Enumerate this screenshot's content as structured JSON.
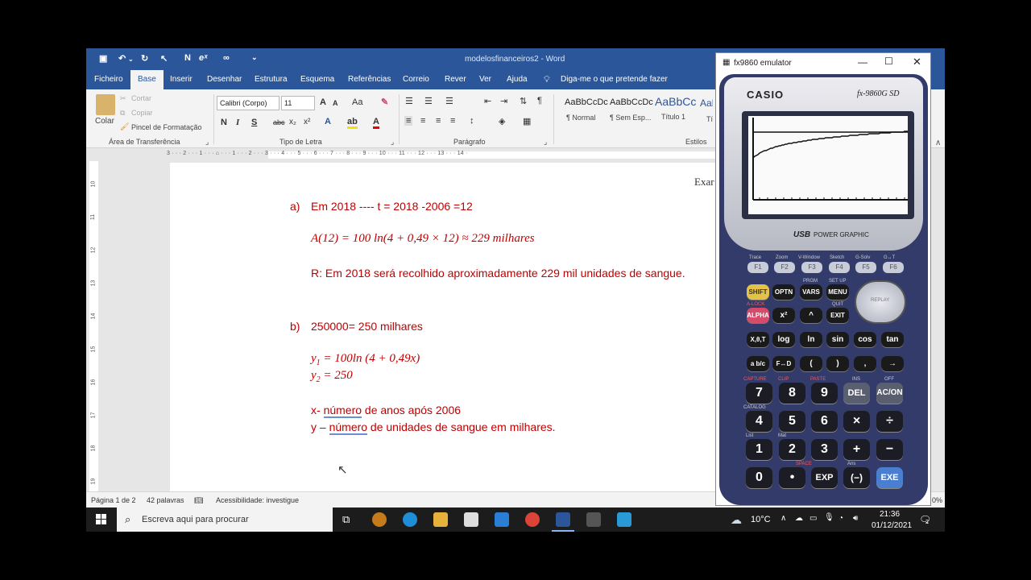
{
  "word": {
    "title": "modelosfinanceiros2 - Word",
    "quick_access": {
      "new_label": "N"
    },
    "tabs": [
      "Ficheiro",
      "Base",
      "Inserir",
      "Desenhar",
      "Estrutura",
      "Esquema",
      "Referências",
      "Correio",
      "Rever",
      "Ver",
      "Ajuda"
    ],
    "active_tab": "Base",
    "tell_me": "Diga-me o que pretende fazer",
    "clipboard": {
      "paste": "Colar",
      "cut": "Cortar",
      "copy": "Copiar",
      "format_painter": "Pincel de Formatação",
      "group": "Área de Transferência"
    },
    "font": {
      "family": "Calibri (Corpo)",
      "size": "11",
      "group": "Tipo de Letra",
      "bold": "N",
      "italic": "I",
      "underline": "S",
      "strike": "abc",
      "sub": "x₂",
      "sup": "x²",
      "grow": "A",
      "shrink": "A",
      "case": "Aa"
    },
    "paragraph": {
      "group": "Parágrafo"
    },
    "styles": {
      "group": "Estilos",
      "items": [
        {
          "sample": "AaBbCcDc",
          "name": "¶ Normal"
        },
        {
          "sample": "AaBbCcDc",
          "name": "¶ Sem Esp..."
        },
        {
          "sample": "AaBbCc",
          "name": "Título 1"
        },
        {
          "sample": "AaB",
          "name": "Tít"
        }
      ]
    },
    "ruler_numbers": "3 · · · 2 · · · 1 · · · ⌂ · · · 1 · · · 2 · · · 3 · · · 4 · · · 5 · · · 6 · · · 7 · · · 8 · · · 9 · · · 10 · · · 11 · · · 12 · · · 13 · · · 14 ·",
    "vruler_numbers": [
      "10",
      "11",
      "12",
      "13",
      "14",
      "15",
      "16",
      "17",
      "18",
      "19"
    ],
    "doc": {
      "header_partial": "Exar",
      "a_label": "a)",
      "a_line": "Em 2018 ---- t = 2018 -2006 =12",
      "a_formula": "A(12) = 100 ln(4 + 0,49 × 12) ≈ 229 milhares",
      "a_answer": "R: Em 2018 será recolhido aproximadamente 229 mil unidades de sangue.",
      "b_label": "b)",
      "b_line": "250000= 250 milhares",
      "y1_var": "y",
      "y1_sub": "1",
      "y1_rest": " = 100ln (4 + 0,49x)",
      "y2_var": "y",
      "y2_sub": "2",
      "y2_rest": " = 250",
      "x_prefix": "x- ",
      "x_word": " número",
      "x_suffix": " de anos após 2006",
      "y_prefix": "y – ",
      "y_word": "número",
      "y_suffix": " de unidades de sangue em milhares."
    },
    "status": {
      "page": "Página 1 de 2",
      "words": "42 palavras",
      "accessibility": "Acessibilidade: investigue",
      "zoom": "0%"
    }
  },
  "emulator": {
    "title": "fx9860 emulator",
    "brand": "CASIO",
    "model": "fx-9860G SD",
    "subtitle_usb": "USB",
    "subtitle_rest": "POWER GRAPHIC",
    "fkeys": [
      "F1",
      "F2",
      "F3",
      "F4",
      "F5",
      "F6"
    ],
    "fkey_labels": [
      "Trace",
      "Zoom",
      "V-Window",
      "Sketch",
      "G-Solv",
      "G↔T"
    ],
    "row1": [
      "SHIFT",
      "OPTN",
      "VARS",
      "MENU"
    ],
    "row2": [
      "ALPHA",
      "x²",
      "^",
      "EXIT"
    ],
    "row3": [
      "X,θ,T",
      "log",
      "ln",
      "sin",
      "cos",
      "tan"
    ],
    "row4": [
      "a b/c",
      "F↔D",
      "(",
      ")",
      ",",
      "→"
    ],
    "num_rows": [
      [
        "7",
        "8",
        "9",
        "DEL",
        "AC/ON"
      ],
      [
        "4",
        "5",
        "6",
        "×",
        "÷"
      ],
      [
        "1",
        "2",
        "3",
        "+",
        "−"
      ],
      [
        "0",
        "•",
        "EXP",
        "(−)",
        "EXE"
      ]
    ],
    "small_labels": {
      "prgm": "PRGM",
      "setup": "SET UP",
      "alock": "A-LOCK",
      "quit": "QUIT",
      "replay": "REPLAY",
      "capture": "CAPTURE",
      "clip": "CLIP",
      "paste": "PASTE",
      "ins": "INS",
      "off": "OFF",
      "catalog": "CATALOG",
      "list": "List",
      "mat": "Mat",
      "space": "SPACE",
      "ans": "Ans"
    }
  },
  "taskbar": {
    "search": "Escreva aqui para procurar",
    "weather": "10°C",
    "time": "21:36",
    "date": "01/12/2021",
    "notif": "2"
  }
}
